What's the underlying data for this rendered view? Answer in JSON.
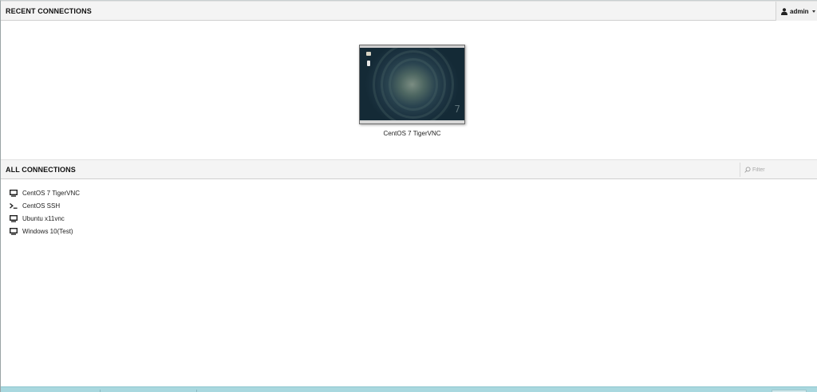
{
  "recent": {
    "header": "RECENT CONNECTIONS",
    "connections": [
      {
        "name": "CentOS 7 TigerVNC",
        "thumbnail_text": "7"
      }
    ]
  },
  "user_menu": {
    "username": "admin",
    "icon": "user-icon"
  },
  "all": {
    "header": "ALL CONNECTIONS",
    "filter_placeholder": "Filter",
    "connections": [
      {
        "name": "CentOS 7 TigerVNC",
        "icon": "desktop-icon"
      },
      {
        "name": "CentOS SSH",
        "icon": "terminal-icon"
      },
      {
        "name": "Ubuntu x11vnc",
        "icon": "desktop-icon"
      },
      {
        "name": "Windows 10(Test)",
        "icon": "desktop-icon"
      }
    ]
  },
  "colors": {
    "header_bg": "#f4f4f4",
    "bottom_bar": "#a9d8df"
  }
}
